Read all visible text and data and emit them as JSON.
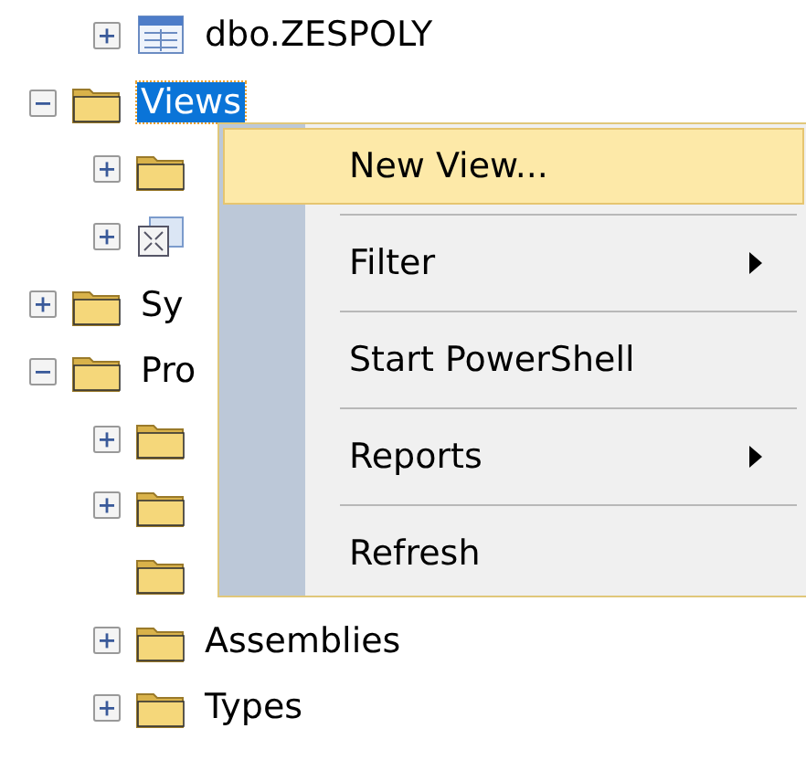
{
  "tree_partial": [
    {
      "label": "dbo.ZESPOLY",
      "kind": "table",
      "expanded": false,
      "selected": false
    }
  ],
  "tree": [
    {
      "label": "Views",
      "kind": "folder",
      "expanded": true,
      "selected": true,
      "children": [
        {
          "kind": "folder",
          "expanded": false,
          "selected": false
        },
        {
          "kind": "view",
          "expanded": false,
          "selected": false
        }
      ]
    },
    {
      "label": "Sy",
      "kind": "folder",
      "expanded": false,
      "selected": false
    },
    {
      "label": "Pro",
      "kind": "folder",
      "expanded": true,
      "selected": false,
      "children": [
        {
          "kind": "folder",
          "expanded": false,
          "selected": false
        },
        {
          "kind": "folder",
          "expanded": false,
          "selected": false
        },
        {
          "kind": "folder",
          "selected": false
        },
        {
          "label": "Assemblies",
          "kind": "folder",
          "expanded": false,
          "selected": false
        },
        {
          "label": "Types",
          "kind": "folder",
          "expanded": false,
          "selected": false
        }
      ]
    }
  ],
  "context_menu": [
    {
      "label": "New View...",
      "submenu": false,
      "selected": true
    },
    {
      "label": "Filter",
      "submenu": true,
      "selected": false
    },
    {
      "label": "Start PowerShell",
      "submenu": false,
      "selected": false
    },
    {
      "label": "Reports",
      "submenu": true,
      "selected": false
    },
    {
      "label": "Refresh",
      "submenu": false,
      "selected": false
    }
  ]
}
